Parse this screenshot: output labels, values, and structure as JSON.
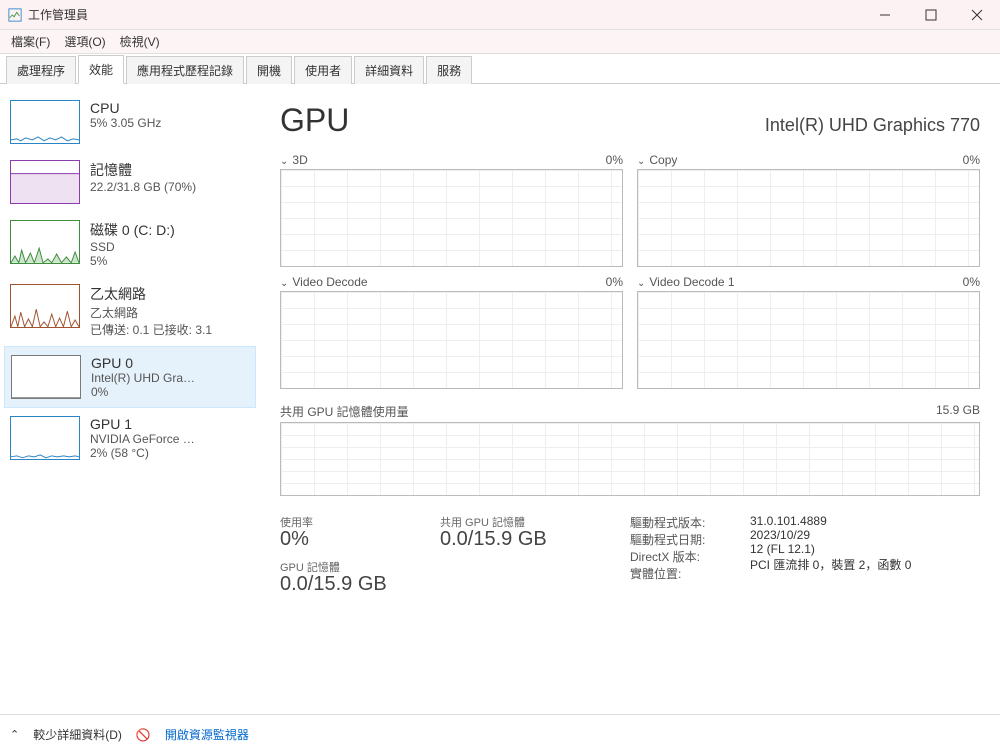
{
  "window": {
    "title": "工作管理員"
  },
  "menu": {
    "file": "檔案(F)",
    "options": "選項(O)",
    "view": "檢視(V)"
  },
  "tabs": {
    "processes": "處理程序",
    "performance": "效能",
    "app_history": "應用程式歷程記錄",
    "startup": "開機",
    "users": "使用者",
    "details": "詳細資料",
    "services": "服務"
  },
  "sidebar": {
    "cpu": {
      "title": "CPU",
      "sub": "5%  3.05 GHz"
    },
    "mem": {
      "title": "記憶體",
      "sub": "22.2/31.8 GB (70%)"
    },
    "disk": {
      "title": "磁碟 0 (C: D:)",
      "sub1": "SSD",
      "sub2": "5%"
    },
    "eth": {
      "title": "乙太網路",
      "sub1": "乙太網路",
      "sub2": "已傳送: 0.1 已接收: 3.1"
    },
    "gpu0": {
      "title": "GPU 0",
      "sub1": "Intel(R) UHD Gra…",
      "sub2": "0%"
    },
    "gpu1": {
      "title": "GPU 1",
      "sub1": "NVIDIA GeForce …",
      "sub2": "2%  (58 °C)"
    }
  },
  "main": {
    "heading": "GPU",
    "model": "Intel(R) UHD Graphics 770",
    "engines": {
      "a": {
        "name": "3D",
        "pct": "0%"
      },
      "b": {
        "name": "Copy",
        "pct": "0%"
      },
      "c": {
        "name": "Video Decode",
        "pct": "0%"
      },
      "d": {
        "name": "Video Decode 1",
        "pct": "0%"
      }
    },
    "shared": {
      "label": "共用 GPU 記憶體使用量",
      "max": "15.9 GB"
    },
    "stats": {
      "util_label": "使用率",
      "util_value": "0%",
      "gpu_mem_label": "GPU 記憶體",
      "gpu_mem_value": "0.0/15.9 GB",
      "shared_mem_label": "共用 GPU 記憶體",
      "shared_mem_value": "0.0/15.9 GB",
      "driver_ver_label": "驅動程式版本:",
      "driver_ver_value": "31.0.101.4889",
      "driver_date_label": "驅動程式日期:",
      "driver_date_value": "2023/10/29",
      "dx_label": "DirectX 版本:",
      "dx_value": "12 (FL 12.1)",
      "loc_label": "實體位置:",
      "loc_value": "PCI 匯流排 0，裝置 2，函數 0"
    }
  },
  "footer": {
    "fewer": "較少詳細資料(D)",
    "resmon": "開啟資源監視器"
  }
}
